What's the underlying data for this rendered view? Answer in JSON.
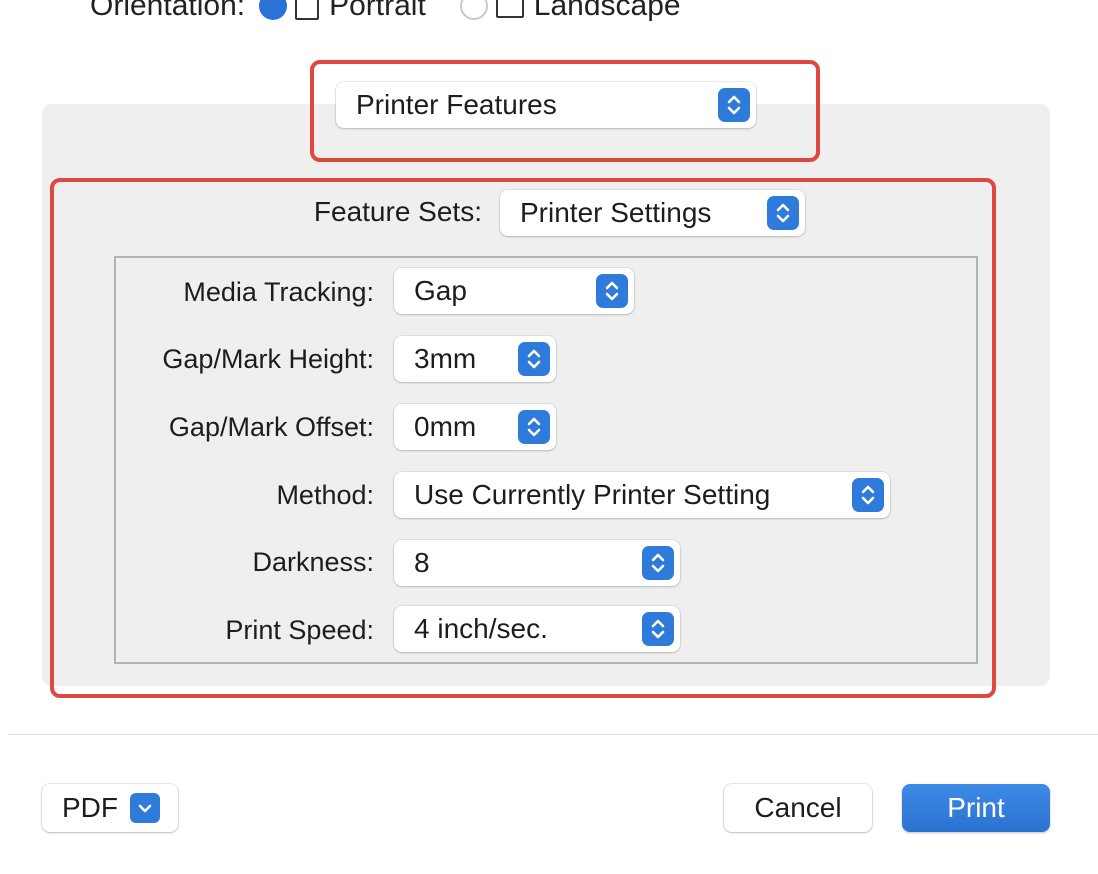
{
  "orientation": {
    "label": "Orientation:",
    "portrait": "Portrait",
    "landscape": "Landscape"
  },
  "section_popup": {
    "value": "Printer Features"
  },
  "feature_sets": {
    "label": "Feature Sets:",
    "value": "Printer Settings"
  },
  "settings": [
    {
      "label": "Media Tracking:",
      "value": "Gap"
    },
    {
      "label": "Gap/Mark Height:",
      "value": "3mm"
    },
    {
      "label": "Gap/Mark Offset:",
      "value": "0mm"
    },
    {
      "label": "Method:",
      "value": "Use Currently Printer Setting"
    },
    {
      "label": "Darkness:",
      "value": "8"
    },
    {
      "label": "Print Speed:",
      "value": "4 inch/sec."
    }
  ],
  "footer": {
    "pdf_label": "PDF",
    "cancel_label": "Cancel",
    "print_label": "Print"
  },
  "icons": {
    "stepper": "updown-chevron-icon",
    "pdf_menu": "chevron-down-icon",
    "portrait": "portrait-icon",
    "landscape": "landscape-icon"
  },
  "colors": {
    "accent": "#2f7bdc",
    "annotation": "#e0473f"
  }
}
